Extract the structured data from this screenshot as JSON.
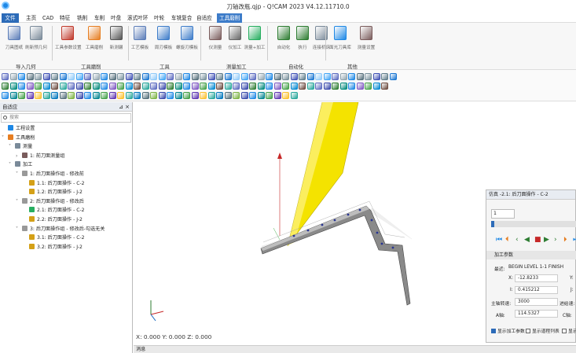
{
  "window": {
    "title": "刀轴改瓶.qjp - Q!CAM 2023 V4.12.11710.0"
  },
  "menu": {
    "file": "文件",
    "tabs": [
      "主页",
      "CAD",
      "特征",
      "铣削",
      "车削",
      "叶盘",
      "滚式叶环",
      "叶轮",
      "车铣复合",
      "自适应",
      "工具磨削"
    ],
    "active_index": 10
  },
  "ribbon": {
    "buttons": [
      {
        "label": "刀具图纸",
        "color": "#5b7db8"
      },
      {
        "label": "刷新预几何",
        "color": "#7a8a99"
      },
      {
        "label": "工具参数设置",
        "color": "#c0392b"
      },
      {
        "label": "工具磨削",
        "color": "#e67e22"
      },
      {
        "label": "新测碾",
        "color": "#555555"
      },
      {
        "label": "工艺模板",
        "color": "#5b7db8"
      },
      {
        "label": "周刃模板",
        "color": "#3d7cc9"
      },
      {
        "label": "螺旋刃模板",
        "color": "#3d7cc9"
      },
      {
        "label": "仪测量",
        "color": "#7a5c5c"
      },
      {
        "label": "仪加工",
        "color": "#666666"
      },
      {
        "label": "测量+加工",
        "color": "#27ae60"
      },
      {
        "label": "自动化",
        "color": "#2e7d32"
      },
      {
        "label": "执行",
        "color": "#2e7d32"
      },
      {
        "label": "连接机床",
        "color": "#7a8a99"
      },
      {
        "label": "面光刀具库",
        "color": "#1e88e5"
      },
      {
        "label": "测量设置",
        "color": "#7a5c5c"
      }
    ],
    "groups": [
      "导入几何",
      "工具磨削",
      "工具",
      "测量加工",
      "自动化",
      "其他"
    ]
  },
  "panel": {
    "title": "自适应",
    "pin": "⊿ ×",
    "search_placeholder": "搜索",
    "tree": [
      {
        "label": "工程设置",
        "level": 0,
        "caret": "",
        "color": "#1e88e5"
      },
      {
        "label": "工具磨削",
        "level": 0,
        "caret": "˅",
        "color": "#e67e22"
      },
      {
        "label": "测量",
        "level": 1,
        "caret": "˅",
        "color": "#7a8a99"
      },
      {
        "label": "1: 前刀面测量组",
        "level": 2,
        "caret": "›",
        "color": "#7a5c5c"
      },
      {
        "label": "加工",
        "level": 1,
        "caret": "˅",
        "color": "#7a8a99"
      },
      {
        "label": "1: 后刀面操作组 - 修改前",
        "level": 2,
        "caret": "˅",
        "color": "#999999"
      },
      {
        "label": "1.1: 后刀面操作 - C-2",
        "level": 3,
        "caret": "",
        "color": "#d4a017"
      },
      {
        "label": "1.2: 后刀面操作 - J-2",
        "level": 3,
        "caret": "",
        "color": "#d4a017"
      },
      {
        "label": "2: 后刀面操作组 - 修改后",
        "level": 2,
        "caret": "˅",
        "color": "#999999"
      },
      {
        "label": "2.1: 后刀面操作 - C-2",
        "level": 3,
        "caret": "",
        "color": "#27ae60"
      },
      {
        "label": "2.2: 后刀面操作 - J-2",
        "level": 3,
        "caret": "",
        "color": "#d4a017"
      },
      {
        "label": "3: 后刀面操作组 - 修改后-勾选无关",
        "level": 2,
        "caret": "˅",
        "color": "#999999"
      },
      {
        "label": "3.1: 后刀面操作 - C-2",
        "level": 3,
        "caret": "",
        "color": "#d4a017"
      },
      {
        "label": "3.2: 后刀面操作 - J-2",
        "level": 3,
        "caret": "",
        "color": "#d4a017"
      }
    ]
  },
  "viewport": {
    "coords": "X: 0.000 Y: 0.000 Z: 0.000"
  },
  "status": {
    "message": "消息"
  },
  "sim": {
    "title": "仿真 -2.1: 后刀面操作 - C-2",
    "step": "1",
    "progress": 0.04,
    "section": "加工参数",
    "recent_label": "最近:",
    "recent_value": "BEGIN LEVEL 1-1 FINISH",
    "x_label": "X:",
    "x_value": "-12.8233",
    "y_label": "Y:",
    "i_label": "I:",
    "i_value": "0.415212",
    "j_label": "J:",
    "spindle_label": "主轴转速:",
    "spindle_value": "3000",
    "feed_label": "进给速:",
    "a_label": "A轴:",
    "a_value": "114.5327",
    "c_label": "C轴:",
    "show_params": "显示加工参数",
    "show_list": "显示道程列表",
    "show_more": "显示"
  }
}
